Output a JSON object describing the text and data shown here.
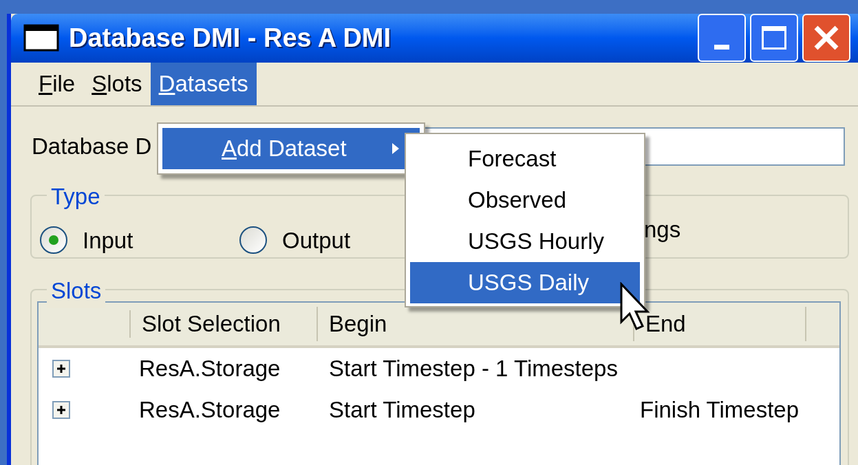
{
  "window": {
    "title": "Database DMI - Res A DMI"
  },
  "menu_bar": [
    {
      "label": "File",
      "selected": false,
      "underline_first": true
    },
    {
      "label": "Slots",
      "selected": false,
      "underline_first": true
    },
    {
      "label": "Datasets",
      "selected": true,
      "underline_first": true
    }
  ],
  "datasets_menu": [
    {
      "label": "Add Dataset",
      "selected": true,
      "underline_first": true,
      "has_submenu": true
    }
  ],
  "add_dataset_submenu": [
    {
      "label": "Forecast",
      "selected": false
    },
    {
      "label": "Observed",
      "selected": false
    },
    {
      "label": "USGS Hourly",
      "selected": false
    },
    {
      "label": "USGS Daily",
      "selected": true
    }
  ],
  "database_field": {
    "label": "Database D"
  },
  "type_group": {
    "title": "Type",
    "options": [
      {
        "label": "Input",
        "selected": true
      },
      {
        "label": "Output",
        "selected": false
      }
    ],
    "partial_text": "ngs"
  },
  "slots_group": {
    "title": "Slots",
    "table": {
      "columns": [
        "Slot Selection",
        "Begin",
        "End"
      ],
      "rows": [
        {
          "expanded": false,
          "slot_selection": "ResA.Storage",
          "begin": "Start Timestep - 1 Timesteps"
        },
        {
          "expanded": false,
          "slot_selection": "ResA.Storage",
          "begin": "Start Timestep",
          "end": "Finish Timestep"
        }
      ]
    }
  }
}
